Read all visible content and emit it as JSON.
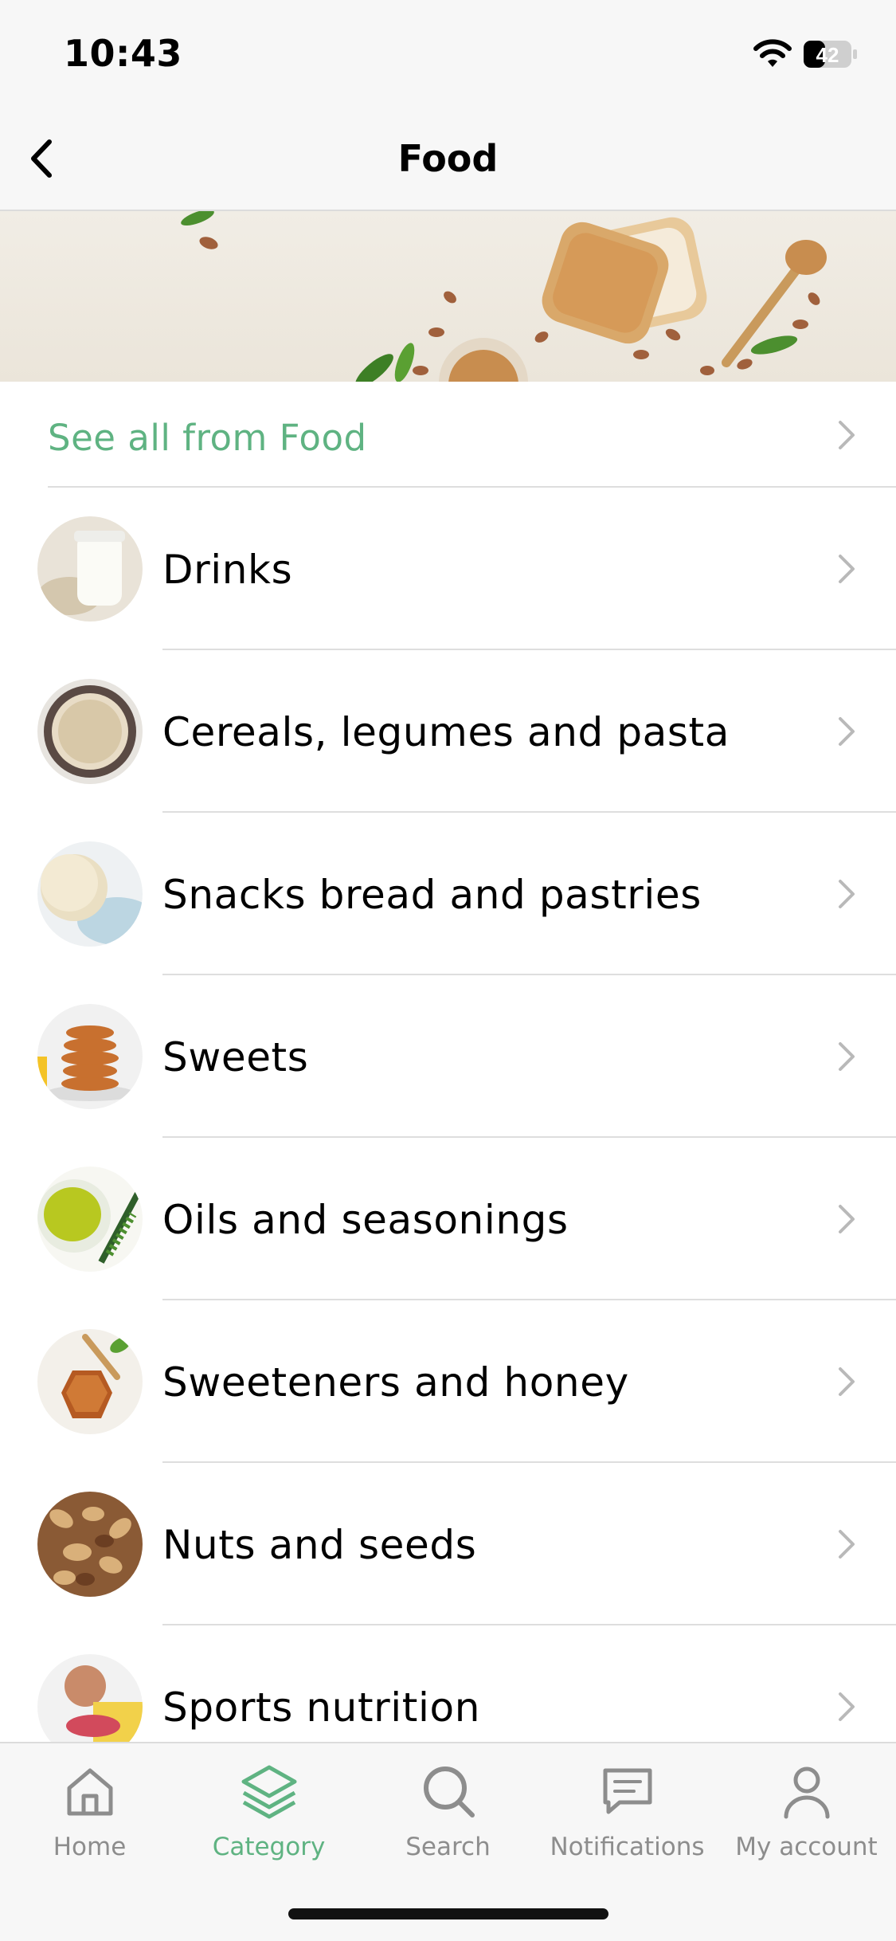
{
  "status_bar": {
    "time": "10:43",
    "battery": "42"
  },
  "nav": {
    "title": "Food",
    "back_icon": "chevron-left-icon"
  },
  "see_all": {
    "label": "See all from Food"
  },
  "categories": [
    {
      "label": "Drinks",
      "image": "milk-jar-image"
    },
    {
      "label": "Cereals, legumes and pasta",
      "image": "oats-bowl-image"
    },
    {
      "label": "Snacks bread and pastries",
      "image": "rice-cakes-image"
    },
    {
      "label": "Sweets",
      "image": "cookie-stack-image"
    },
    {
      "label": "Oils and seasonings",
      "image": "olive-oil-image"
    },
    {
      "label": "Sweeteners and honey",
      "image": "honey-jar-image"
    },
    {
      "label": "Nuts and seeds",
      "image": "mixed-nuts-image"
    },
    {
      "label": "Sports nutrition",
      "image": "athlete-bowl-image"
    }
  ],
  "tabs": [
    {
      "label": "Home",
      "icon": "home-icon",
      "active": false
    },
    {
      "label": "Category",
      "icon": "layers-icon",
      "active": true
    },
    {
      "label": "Search",
      "icon": "search-icon",
      "active": false
    },
    {
      "label": "Notifications",
      "icon": "message-icon",
      "active": false
    },
    {
      "label": "My account",
      "icon": "user-icon",
      "active": false
    }
  ],
  "colors": {
    "accent": "#5fb382",
    "inactive": "#8d8d8d",
    "divider": "#dedede",
    "bar_bg": "#f7f7f7"
  }
}
